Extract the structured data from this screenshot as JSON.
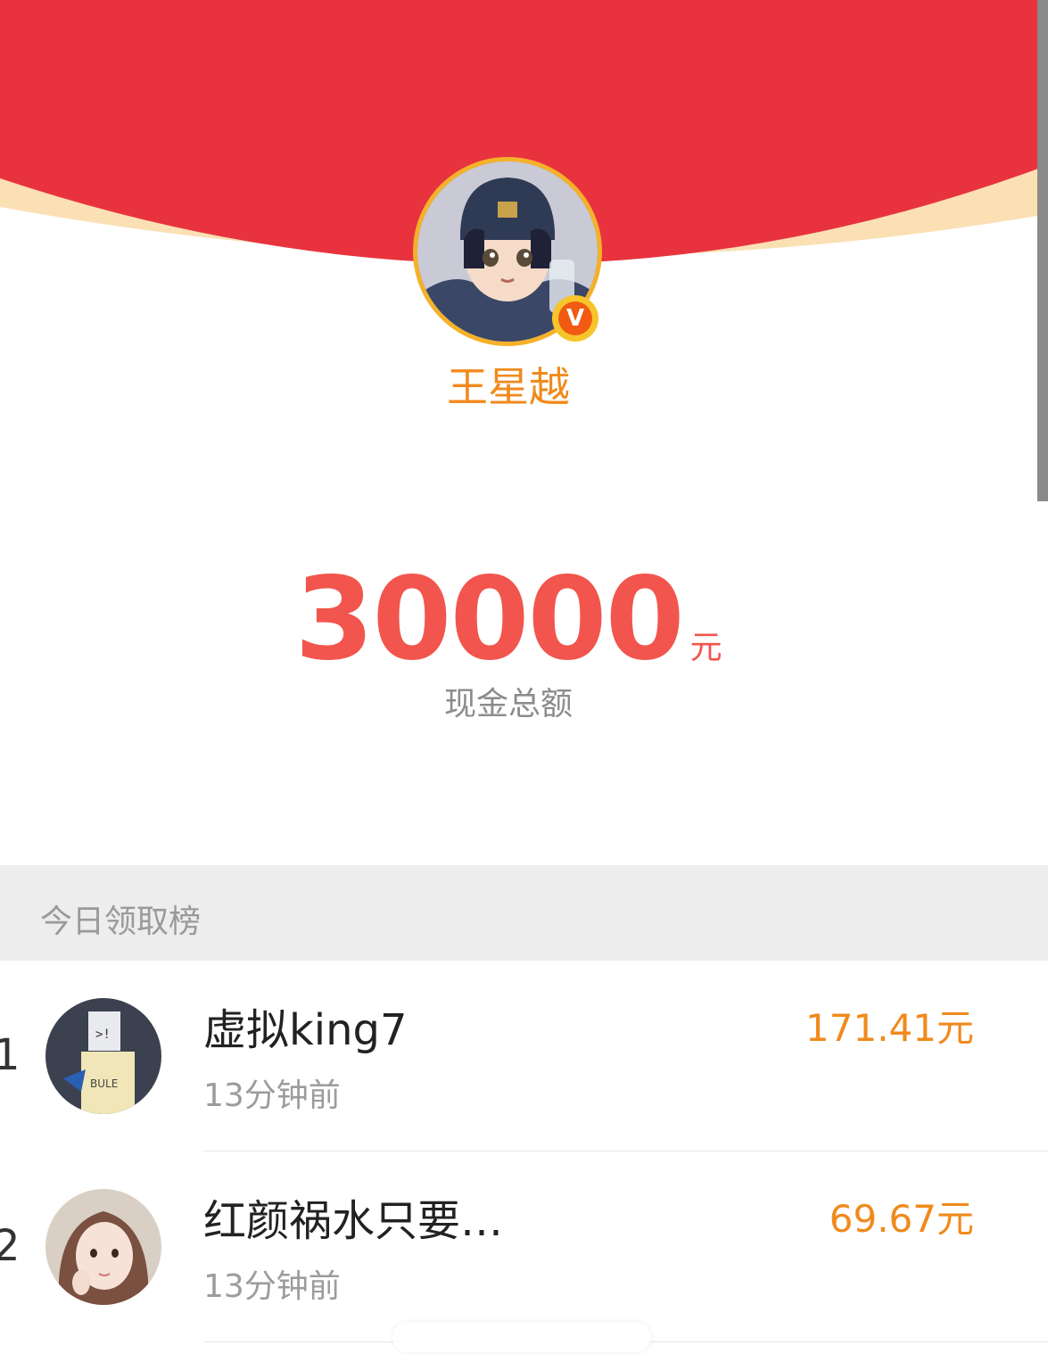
{
  "colors": {
    "header_red": "#e8333f",
    "header_rim": "#fbe0b4",
    "accent_orange": "#f08a1c",
    "amount_red": "#f2554d",
    "muted_gray": "#9c9c9c",
    "section_bg": "#ededed"
  },
  "profile": {
    "name": "王星越",
    "avatar_icon": "profile-avatar-illustration",
    "badge_icon": "verified-v-icon",
    "badge_text": "V"
  },
  "summary": {
    "amount": "30000",
    "unit": "元",
    "label": "现金总额"
  },
  "leaderboard": {
    "title": "今日领取榜",
    "rows": [
      {
        "rank": "1",
        "name": "虚拟king7",
        "time": "13分钟前",
        "amount": "171.41元"
      },
      {
        "rank": "2",
        "name": "红颜祸水只要…",
        "time": "13分钟前",
        "amount": "69.67元"
      }
    ]
  }
}
